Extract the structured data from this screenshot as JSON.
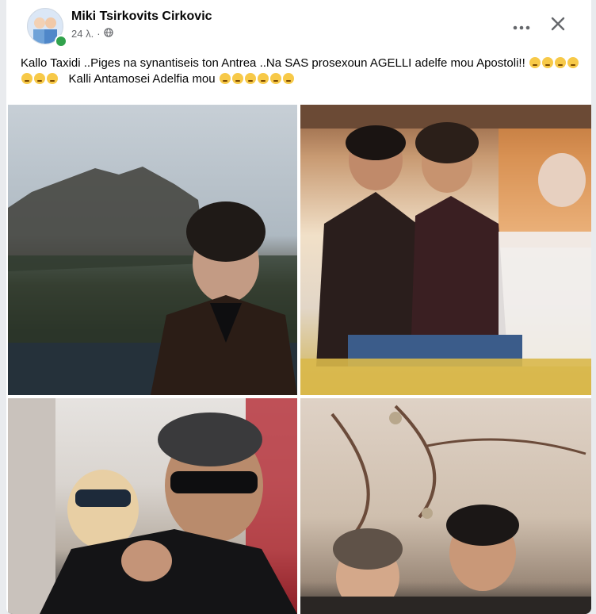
{
  "post": {
    "author": "Miki Tsirkovits Cirkovic",
    "time": "24 λ.",
    "separator": "·",
    "text_part1": "Kallo Taxidi ..Piges na synantiseis ton Antrea ..Na SAS prosexoun AGELLI adelfe mou Apostoli!!",
    "text_part2": "Kalli Antamosei Adelfia mou",
    "emoji_run1_count": 7,
    "emoji_run2_count": 6,
    "emoji_name": "crying-face-emoji"
  },
  "icons": {
    "privacy": "globe-icon",
    "more": "more-options-icon",
    "close": "close-icon"
  },
  "photos": [
    {
      "name": "photo-man-curly-hair-castle"
    },
    {
      "name": "photo-two-men-at-table"
    },
    {
      "name": "photo-man-sunglasses-pointing"
    },
    {
      "name": "photo-two-men-vintage"
    }
  ],
  "colors": {
    "text": "#050505",
    "secondary": "#65676b",
    "online": "#31a24c"
  }
}
